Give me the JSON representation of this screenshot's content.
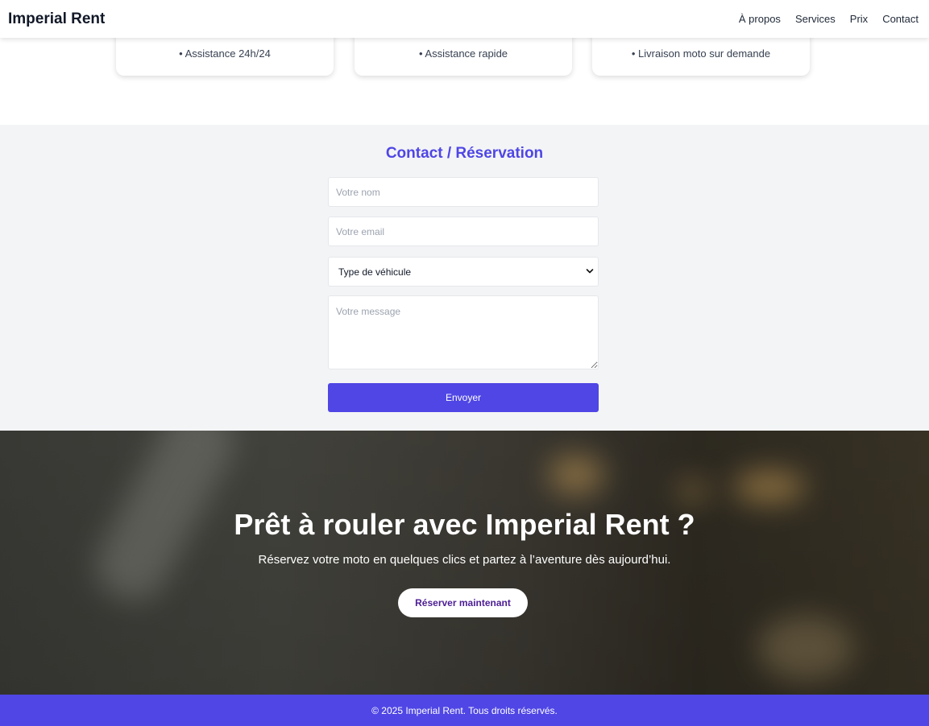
{
  "header": {
    "brand": "Imperial Rent",
    "nav": [
      "À propos",
      "Services",
      "Prix",
      "Contact"
    ]
  },
  "services": {
    "cards": [
      {
        "feature": "• Assistance 24h/24"
      },
      {
        "feature": "• Assistance rapide"
      },
      {
        "feature": "• Livraison moto sur demande"
      }
    ]
  },
  "contact": {
    "title": "Contact / Réservation",
    "name_placeholder": "Votre nom",
    "email_placeholder": "Votre email",
    "vehicle_type_selected": "Type de véhicule",
    "message_placeholder": "Votre message",
    "submit_label": "Envoyer"
  },
  "cta": {
    "title": "Prêt à rouler avec Imperial Rent ?",
    "subtitle": "Réservez votre moto en quelques clics et partez à l’aventure dès aujourd’hui.",
    "button_label": "Réserver maintenant"
  },
  "footer": {
    "copyright": "© 2025 Imperial Rent. Tous droits réservés."
  },
  "colors": {
    "accent": "#4f46e5",
    "section_bg": "#f3f4f6",
    "cta_button_text": "#4c1d95"
  },
  "icons": {
    "select_chevron": "chevron-down-icon"
  }
}
